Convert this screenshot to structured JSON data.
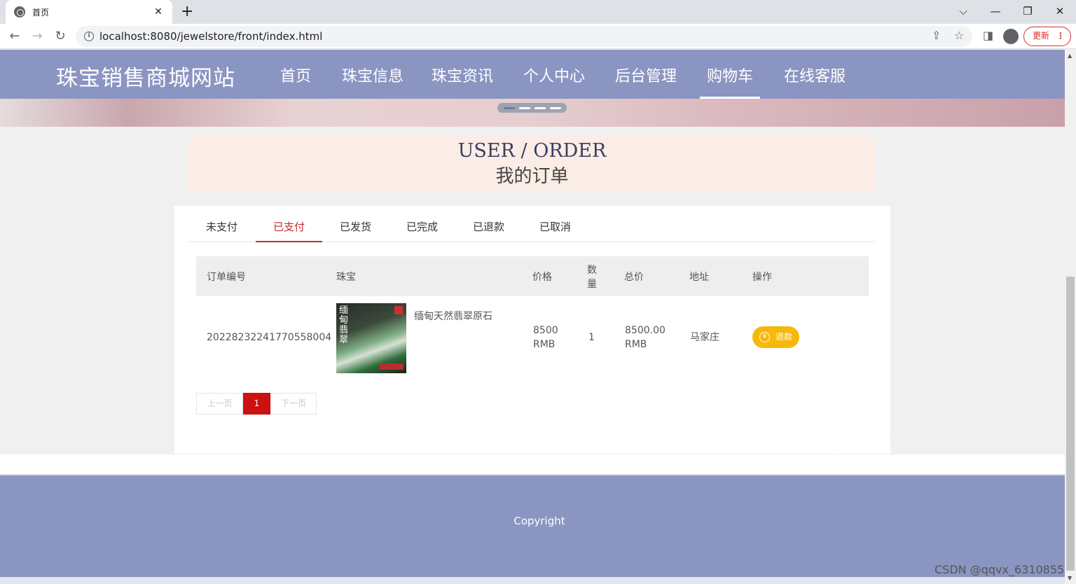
{
  "browser": {
    "tab_title": "首页",
    "tab_close": "✕",
    "new_tab": "+",
    "url": "localhost:8080/jewelstore/front/index.html",
    "update_label": "更新",
    "win_controls": {
      "dropdown": "⌵",
      "minimize": "—",
      "restore": "❐",
      "close": "✕"
    }
  },
  "site": {
    "title": "珠宝销售商城网站",
    "nav": [
      {
        "label": "首页"
      },
      {
        "label": "珠宝信息"
      },
      {
        "label": "珠宝资讯"
      },
      {
        "label": "个人中心"
      },
      {
        "label": "后台管理"
      },
      {
        "label": "购物车",
        "active": true
      },
      {
        "label": "在线客服"
      }
    ]
  },
  "page_title": {
    "en": "USER / ORDER",
    "cn": "我的订单"
  },
  "order_tabs": [
    {
      "label": "未支付"
    },
    {
      "label": "已支付",
      "active": true
    },
    {
      "label": "已发货"
    },
    {
      "label": "已完成"
    },
    {
      "label": "已退款"
    },
    {
      "label": "已取消"
    }
  ],
  "table": {
    "headers": {
      "order_no": "订单编号",
      "jewel": "珠宝",
      "price": "价格",
      "qty_1": "数",
      "qty_2": "量",
      "total": "总价",
      "address": "地址",
      "action": "操作"
    },
    "rows": [
      {
        "order_no": "20228232241770558004",
        "product_name": "缅甸天然翡翠原石",
        "image_text": "缅甸翡翠",
        "price_value": "8500",
        "price_unit": "RMB",
        "quantity": "1",
        "total_value": "8500.00",
        "total_unit": "RMB",
        "address": "马家庄",
        "action_label": "退款",
        "action_icon": "¥"
      }
    ]
  },
  "pagination": {
    "prev": "上一页",
    "current": "1",
    "next": "下一页"
  },
  "footer": {
    "copyright": "Copyright"
  },
  "watermark": "CSDN @qqvx_6310855"
}
